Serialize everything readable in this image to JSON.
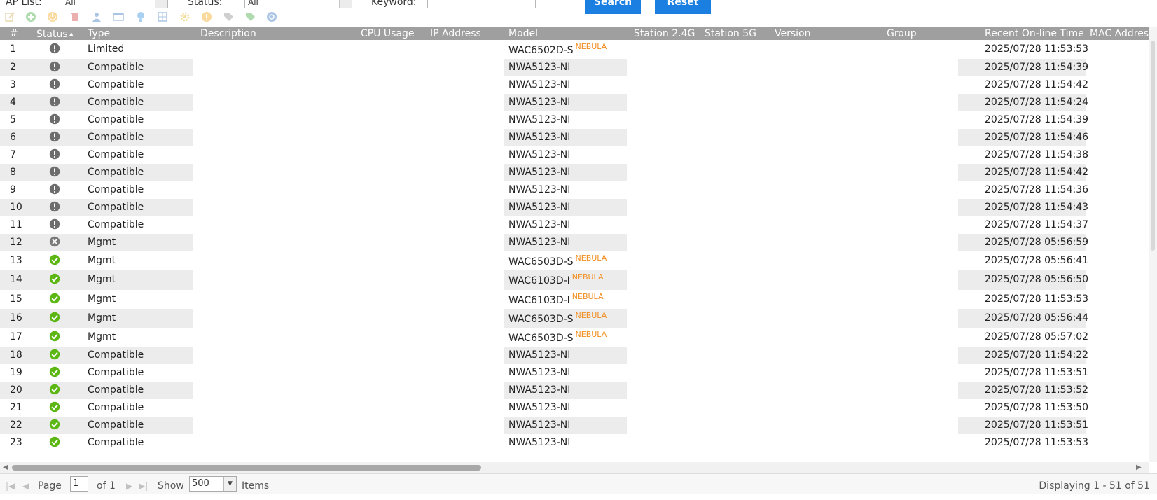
{
  "filters": {
    "ap_list_label": "AP List:",
    "ap_list_value": "All",
    "status_label": "Status:",
    "status_value": "All",
    "keyword_label": "Keyword:",
    "keyword_value": "",
    "search_label": "Search",
    "reset_label": "Reset"
  },
  "toolbar": {
    "icons": [
      "edit-icon",
      "add-icon",
      "power-icon",
      "delete-icon",
      "user-icon",
      "window-icon",
      "lightbulb-icon",
      "network-icon",
      "settings-icon",
      "warning-icon",
      "tag-icon",
      "tag-add-icon",
      "refresh-icon"
    ]
  },
  "columns": {
    "num": "#",
    "status": "Status",
    "type": "Type",
    "description": "Description",
    "cpu": "CPU Usage",
    "ip": "IP Address",
    "model": "Model",
    "station24": "Station 2.4G",
    "station5": "Station 5G",
    "version": "Version",
    "group": "Group",
    "recent_time": "Recent On-line Time",
    "mac": "MAC Address"
  },
  "status_icons": {
    "limited": "exclamation-icon",
    "mgmt_off": "x-circle-icon",
    "online": "check-circle-icon"
  },
  "colors": {
    "header": "#9f9f9f",
    "shade": "#ececec",
    "selected": "#c9c9c9",
    "nebula": "#f28e1f",
    "online": "#5cb614",
    "warn": "#6d6d6d",
    "button": "#1a7fe0"
  },
  "rows": [
    {
      "num": "1",
      "status": "limited",
      "type": "Limited",
      "model": "WAC6502D-S",
      "nebula": "NEBULA",
      "time": "2025/07/28 11:53:53"
    },
    {
      "num": "2",
      "status": "limited",
      "type": "Compatible",
      "model": "NWA5123-NI",
      "nebula": "",
      "time": "2025/07/28 11:54:39"
    },
    {
      "num": "3",
      "status": "limited",
      "type": "Compatible",
      "model": "NWA5123-NI",
      "nebula": "",
      "time": "2025/07/28 11:54:42"
    },
    {
      "num": "4",
      "status": "limited",
      "type": "Compatible",
      "model": "NWA5123-NI",
      "nebula": "",
      "time": "2025/07/28 11:54:24"
    },
    {
      "num": "5",
      "status": "limited",
      "type": "Compatible",
      "model": "NWA5123-NI",
      "nebula": "",
      "time": "2025/07/28 11:54:39"
    },
    {
      "num": "6",
      "status": "limited",
      "type": "Compatible",
      "model": "NWA5123-NI",
      "nebula": "",
      "time": "2025/07/28 11:54:46"
    },
    {
      "num": "7",
      "status": "limited",
      "type": "Compatible",
      "model": "NWA5123-NI",
      "nebula": "",
      "time": "2025/07/28 11:54:38"
    },
    {
      "num": "8",
      "status": "limited",
      "type": "Compatible",
      "model": "NWA5123-NI",
      "nebula": "",
      "time": "2025/07/28 11:54:42"
    },
    {
      "num": "9",
      "status": "limited",
      "type": "Compatible",
      "model": "NWA5123-NI",
      "nebula": "",
      "time": "2025/07/28 11:54:36"
    },
    {
      "num": "10",
      "status": "limited",
      "type": "Compatible",
      "model": "NWA5123-NI",
      "nebula": "",
      "time": "2025/07/28 11:54:43"
    },
    {
      "num": "11",
      "status": "limited",
      "type": "Compatible",
      "model": "NWA5123-NI",
      "nebula": "",
      "time": "2025/07/28 11:54:37"
    },
    {
      "num": "12",
      "status": "mgmt_off",
      "type": "Mgmt",
      "model": "NWA5123-NI",
      "nebula": "",
      "time": "2025/07/28 05:56:59"
    },
    {
      "num": "13",
      "status": "online",
      "type": "Mgmt",
      "model": "WAC6503D-S",
      "nebula": "NEBULA",
      "time": "2025/07/28 05:56:41"
    },
    {
      "num": "14",
      "status": "online",
      "type": "Mgmt",
      "model": "WAC6103D-I",
      "nebula": "NEBULA",
      "time": "2025/07/28 05:56:50"
    },
    {
      "num": "15",
      "status": "online",
      "type": "Mgmt",
      "model": "WAC6103D-I",
      "nebula": "NEBULA",
      "time": "2025/07/28 11:53:53"
    },
    {
      "num": "16",
      "status": "online",
      "type": "Mgmt",
      "model": "WAC6503D-S",
      "nebula": "NEBULA",
      "time": "2025/07/28 05:56:44"
    },
    {
      "num": "17",
      "status": "online",
      "type": "Mgmt",
      "model": "WAC6503D-S",
      "nebula": "NEBULA",
      "time": "2025/07/28 05:57:02"
    },
    {
      "num": "18",
      "status": "online",
      "type": "Compatible",
      "model": "NWA5123-NI",
      "nebula": "",
      "time": "2025/07/28 11:54:22"
    },
    {
      "num": "19",
      "status": "online",
      "type": "Compatible",
      "model": "NWA5123-NI",
      "nebula": "",
      "time": "2025/07/28 11:53:51",
      "selected": true
    },
    {
      "num": "20",
      "status": "online",
      "type": "Compatible",
      "model": "NWA5123-NI",
      "nebula": "",
      "time": "2025/07/28 11:53:52"
    },
    {
      "num": "21",
      "status": "online",
      "type": "Compatible",
      "model": "NWA5123-NI",
      "nebula": "",
      "time": "2025/07/28 11:53:50"
    },
    {
      "num": "22",
      "status": "online",
      "type": "Compatible",
      "model": "NWA5123-NI",
      "nebula": "",
      "time": "2025/07/28 11:53:51"
    },
    {
      "num": "23",
      "status": "online",
      "type": "Compatible",
      "model": "NWA5123-NI",
      "nebula": "",
      "time": "2025/07/28 11:53:53"
    }
  ],
  "pager": {
    "page_label": "Page",
    "page_value": "1",
    "of_label": "of 1",
    "show_label": "Show",
    "show_value": "500",
    "items_label": "Items",
    "display_info": "Displaying 1 - 51 of 51"
  }
}
